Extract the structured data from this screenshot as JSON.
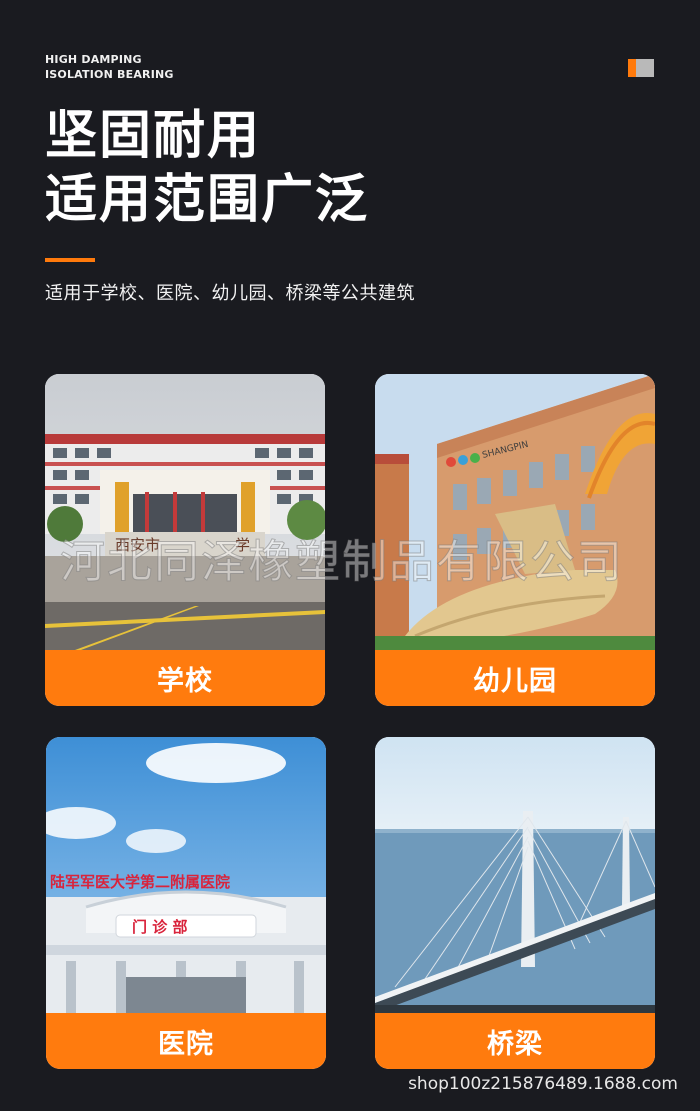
{
  "header": {
    "eyebrow_line1": "HIGH DAMPING",
    "eyebrow_line2": "ISOLATION BEARING",
    "headline_line1": "坚固耐用",
    "headline_line2": "适用范围广泛",
    "subtitle": "适用于学校、医院、幼儿园、桥梁等公共建筑"
  },
  "cards": [
    {
      "label": "学校",
      "photo_sign": "西安市",
      "photo_sign2": "学"
    },
    {
      "label": "幼儿园",
      "photo_sign": "SHANGPIN"
    },
    {
      "label": "医院",
      "photo_sign": "陆军军医大学第二附属医院",
      "photo_sign2": "门 诊 部"
    },
    {
      "label": "桥梁"
    }
  ],
  "watermark": "河北同泽橡塑制品有限公司",
  "footer": {
    "url": "shop100z215876489.1688.com"
  },
  "colors": {
    "background": "#1a1b20",
    "accent": "#ff7b0e",
    "brand_gray": "#b9b9b9"
  }
}
